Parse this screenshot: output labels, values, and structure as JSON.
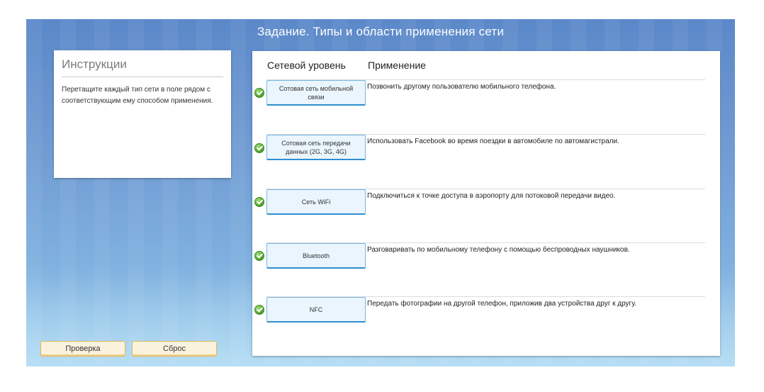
{
  "title": "Задание. Типы и области применения сети",
  "instructions": {
    "heading": "Инструкции",
    "text": "Перетащите каждый тип сети в поле рядом с соответствующим ему способом применения."
  },
  "buttons": {
    "check": "Проверка",
    "reset": "Сброс"
  },
  "columns": {
    "level": "Сетевой уровень",
    "application": "Применение"
  },
  "rows": [
    {
      "network": "Сотовая сеть мобильной связи",
      "application": "Позвонить другому пользователю мобильного телефона.",
      "status": "correct"
    },
    {
      "network": "Сотовая сеть передачи данных (2G, 3G, 4G)",
      "application": "Использовать Facebook во время поездки в автомобиле по автомагистрали.",
      "status": "correct"
    },
    {
      "network": "Сеть WiFi",
      "application": "Подключиться к точке доступа в аэропорту для потоковой передачи видео.",
      "status": "correct"
    },
    {
      "network": "Bluetooth",
      "application": "Разговаривать по мобильному телефону с помощью беспроводных наушников.",
      "status": "correct"
    },
    {
      "network": "NFC",
      "application": "Передать фотографии на другой телефон, приложив два устройства друг к другу.",
      "status": "correct"
    }
  ],
  "colors": {
    "background_top": "#5b88c9",
    "background_bottom": "#a7d3ee",
    "tile_border": "#2f8fd0",
    "check_green": "#4e9e2c",
    "button_border": "#e4b65a"
  }
}
